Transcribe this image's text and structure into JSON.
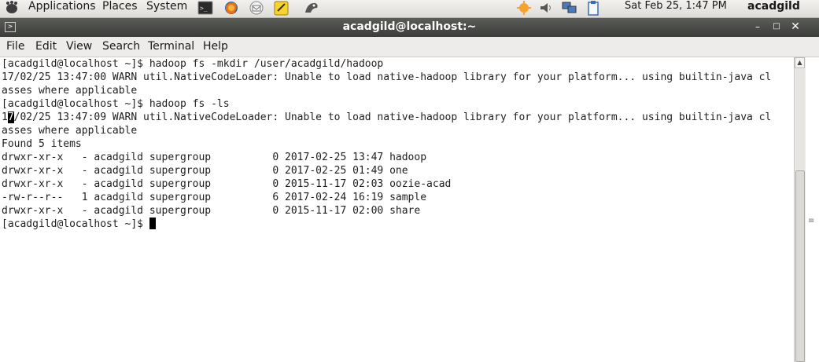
{
  "panel": {
    "menus": [
      "Applications",
      "Places",
      "System"
    ],
    "datetime": "Sat Feb 25,  1:47 PM",
    "username": "acadgild"
  },
  "window": {
    "title": "acadgild@localhost:~"
  },
  "menubar": [
    "File",
    "Edit",
    "View",
    "Search",
    "Terminal",
    "Help"
  ],
  "terminal": {
    "lines": [
      "[acadgild@localhost ~]$ hadoop fs -mkdir /user/acadgild/hadoop",
      "17/02/25 13:47:00 WARN util.NativeCodeLoader: Unable to load native-hadoop library for your platform... using builtin-java cl",
      "asses where applicable",
      "[acadgild@localhost ~]$ hadoop fs -ls",
      "17/02/25 13:47:09 WARN util.NativeCodeLoader: Unable to load native-hadoop library for your platform... using builtin-java cl",
      "asses where applicable",
      "Found 5 items",
      "drwxr-xr-x   - acadgild supergroup          0 2017-02-25 13:47 hadoop",
      "drwxr-xr-x   - acadgild supergroup          0 2017-02-25 01:49 one",
      "drwxr-xr-x   - acadgild supergroup          0 2015-11-17 02:03 oozie-acad",
      "-rw-r--r--   1 acadgild supergroup          6 2017-02-24 16:19 sample",
      "drwxr-xr-x   - acadgild supergroup          0 2015-11-17 02:00 share"
    ],
    "prompt": "[acadgild@localhost ~]$ "
  },
  "icons": {
    "panel_launchers": [
      "terminal-launcher-icon",
      "firefox-icon",
      "mail-icon",
      "notes-icon",
      "network-monitor-icon"
    ],
    "tray": [
      "update-notifier-icon",
      "volume-icon",
      "network-icon",
      "clipboard-icon"
    ]
  }
}
